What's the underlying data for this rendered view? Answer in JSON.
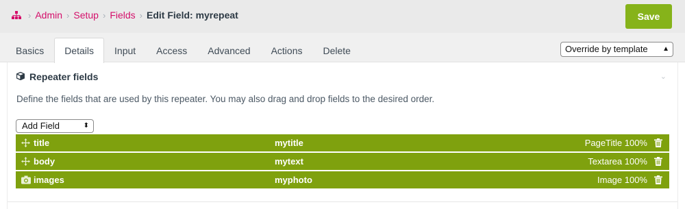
{
  "breadcrumb": {
    "items": [
      "Admin",
      "Setup",
      "Fields"
    ],
    "current": "Edit Field: myrepeat"
  },
  "toolbar": {
    "save_label": "Save"
  },
  "tabs": [
    {
      "label": "Basics"
    },
    {
      "label": "Details",
      "active": true
    },
    {
      "label": "Input"
    },
    {
      "label": "Access"
    },
    {
      "label": "Advanced"
    },
    {
      "label": "Actions"
    },
    {
      "label": "Delete"
    }
  ],
  "override_select": {
    "value": "Override by template"
  },
  "section": {
    "title": "Repeater fields",
    "description": "Define the fields that are used by this repeater. You may also drag and drop fields to the desired order."
  },
  "add_field": {
    "value": "Add Field"
  },
  "fields": [
    {
      "name": "title",
      "label": "mytitle",
      "type": "PageTitle 100%",
      "icon": "move-arrows-icon"
    },
    {
      "name": "body",
      "label": "mytext",
      "type": "Textarea 100%",
      "icon": "move-arrows-icon"
    },
    {
      "name": "images",
      "label": "myphoto",
      "type": "Image 100%",
      "icon": "camera-icon"
    }
  ],
  "colors": {
    "accent_green": "#86b31a",
    "row_green": "#7fa10e",
    "link_pink": "#d40e6a"
  }
}
